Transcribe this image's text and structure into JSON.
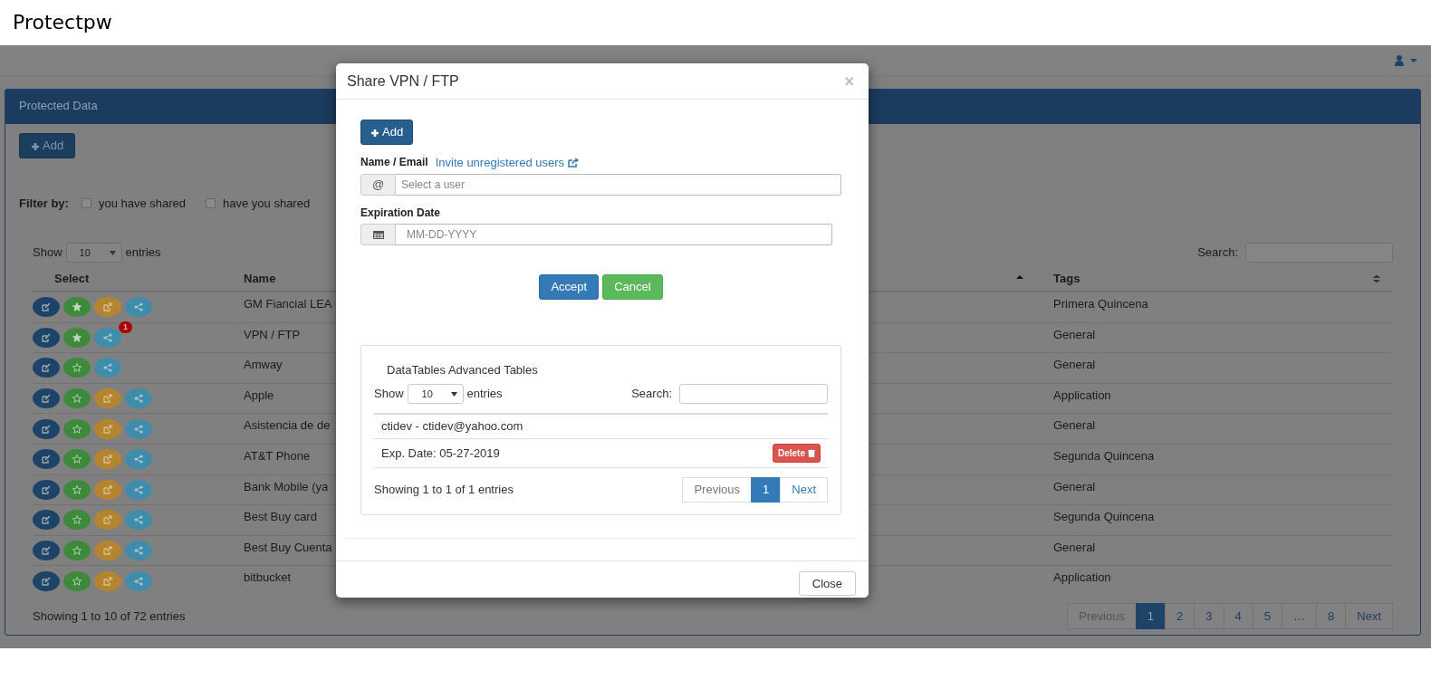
{
  "page_title": "Protectpw",
  "panel": {
    "title": "Protected Data",
    "add_button": "Add",
    "filter": {
      "label": "Filter by:",
      "options": [
        {
          "label": "you have shared",
          "checked": false
        },
        {
          "label": "have you shared",
          "checked": false
        }
      ]
    },
    "length": {
      "show": "Show",
      "value": "10",
      "entries": "entries"
    },
    "search_label": "Search:",
    "columns": [
      {
        "label": "Select",
        "sortable": false
      },
      {
        "label": "Name",
        "sorted": true,
        "sortable": true
      },
      {
        "label": "Tags",
        "sorted": false,
        "sortable": true
      }
    ],
    "rows": [
      {
        "actions": [
          {
            "kind": "edit"
          },
          {
            "kind": "star"
          },
          {
            "kind": "external"
          },
          {
            "kind": "share"
          }
        ],
        "starred": true,
        "name": "GM Fiancial LEA",
        "tag": "Primera Quincena"
      },
      {
        "actions": [
          {
            "kind": "edit"
          },
          {
            "kind": "star"
          },
          {
            "kind": "share"
          }
        ],
        "starred": true,
        "badge": "1",
        "name": "VPN / FTP",
        "tag": "General"
      },
      {
        "actions": [
          {
            "kind": "edit"
          },
          {
            "kind": "star"
          },
          {
            "kind": "share"
          }
        ],
        "starred": false,
        "name": "Amway",
        "tag": "General"
      },
      {
        "actions": [
          {
            "kind": "edit"
          },
          {
            "kind": "star"
          },
          {
            "kind": "external"
          },
          {
            "kind": "share"
          }
        ],
        "starred": false,
        "name": "Apple",
        "tag": "Application"
      },
      {
        "actions": [
          {
            "kind": "edit"
          },
          {
            "kind": "star"
          },
          {
            "kind": "external"
          },
          {
            "kind": "share"
          }
        ],
        "starred": false,
        "name": "Asistencia de de",
        "tag": "General"
      },
      {
        "actions": [
          {
            "kind": "edit"
          },
          {
            "kind": "star"
          },
          {
            "kind": "external"
          },
          {
            "kind": "share"
          }
        ],
        "starred": false,
        "name": "AT&T Phone",
        "tag": "Segunda Quincena"
      },
      {
        "actions": [
          {
            "kind": "edit"
          },
          {
            "kind": "star"
          },
          {
            "kind": "external"
          },
          {
            "kind": "share"
          }
        ],
        "starred": false,
        "name": "Bank Mobile (ya",
        "tag": "General"
      },
      {
        "actions": [
          {
            "kind": "edit"
          },
          {
            "kind": "star"
          },
          {
            "kind": "external"
          },
          {
            "kind": "share"
          }
        ],
        "starred": false,
        "name": "Best Buy card",
        "tag": "Segunda Quincena"
      },
      {
        "actions": [
          {
            "kind": "edit"
          },
          {
            "kind": "star"
          },
          {
            "kind": "external"
          },
          {
            "kind": "share"
          }
        ],
        "starred": false,
        "name": "Best Buy Cuenta",
        "tag": "General"
      },
      {
        "actions": [
          {
            "kind": "edit"
          },
          {
            "kind": "star"
          },
          {
            "kind": "external"
          },
          {
            "kind": "share"
          }
        ],
        "starred": false,
        "name": "bitbucket",
        "tag": "Application"
      }
    ],
    "info": "Showing 1 to 10 of 72 entries",
    "pagination": [
      {
        "label": "Previous",
        "selected": false
      },
      {
        "label": "1",
        "selected": true
      },
      {
        "label": "2",
        "selected": false
      },
      {
        "label": "3",
        "selected": false
      },
      {
        "label": "4",
        "selected": false
      },
      {
        "label": "5",
        "selected": false
      },
      {
        "label": "…",
        "selected": false
      },
      {
        "label": "8",
        "selected": false
      },
      {
        "label": "Next",
        "selected": false
      }
    ]
  },
  "modal": {
    "title": "Share VPN / FTP",
    "close": "×",
    "add_button": "Add",
    "name_label": "Name / Email",
    "invite_link": "Invite unregistered users",
    "user_field": {
      "addon": "@",
      "placeholder": "Select a user"
    },
    "date_label": "Expiration Date",
    "date_field": {
      "placeholder": "MM-DD-YYYY"
    },
    "buttons": [
      {
        "label": "Accept",
        "kind": "primary"
      },
      {
        "label": "Cancel",
        "kind": "success"
      }
    ],
    "shares": {
      "title": "DataTables Advanced Tables",
      "length": {
        "show": "Show",
        "value": "10",
        "entries": "entries"
      },
      "search_label": "Search:",
      "entries": [
        {
          "user": "ctidev - ctidev@yahoo.com",
          "expires": "Exp. Date: 05-27-2019",
          "delete": "Delete"
        }
      ],
      "info": "Showing 1 to 1 of 1 entries",
      "pagination": [
        {
          "label": "Previous",
          "selected": false
        },
        {
          "label": "1",
          "selected": true
        },
        {
          "label": "Next",
          "selected": false
        }
      ]
    },
    "close_button": "Close"
  }
}
